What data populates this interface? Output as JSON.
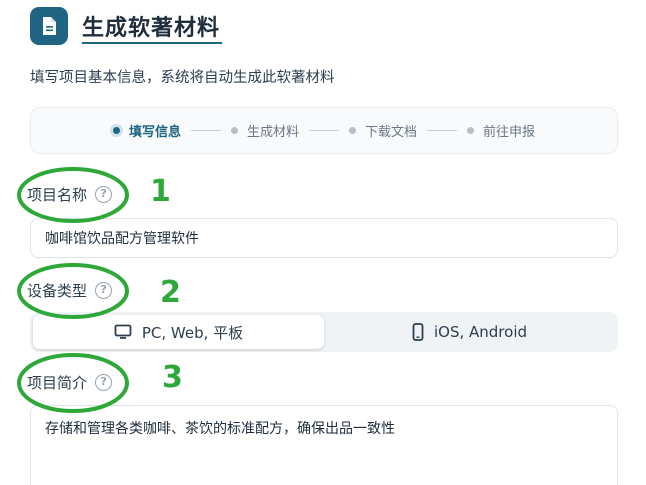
{
  "header": {
    "title": "生成软著材料",
    "icon": "document-icon"
  },
  "subtitle": "填写项目基本信息，系统将自动生成此软著材料",
  "stepper": {
    "steps": [
      {
        "label": "填写信息",
        "active": true
      },
      {
        "label": "生成材料",
        "active": false
      },
      {
        "label": "下载文档",
        "active": false
      },
      {
        "label": "前往申报",
        "active": false
      }
    ]
  },
  "fields": {
    "project_name": {
      "label": "项目名称",
      "value": "咖啡馆饮品配方管理软件",
      "help": "?"
    },
    "device_type": {
      "label": "设备类型",
      "help": "?",
      "options": [
        {
          "label": "PC, Web, 平板",
          "icon": "monitor-icon",
          "selected": true
        },
        {
          "label": "iOS, Android",
          "icon": "phone-icon",
          "selected": false
        }
      ]
    },
    "project_intro": {
      "label": "项目简介",
      "value": "存储和管理各类咖啡、茶饮的标准配方，确保出品一致性",
      "help": "?"
    }
  },
  "annotations": {
    "color": "#2fa83a",
    "numbers": [
      "1",
      "2",
      "3"
    ]
  },
  "colors": {
    "accent": "#1f6482"
  }
}
